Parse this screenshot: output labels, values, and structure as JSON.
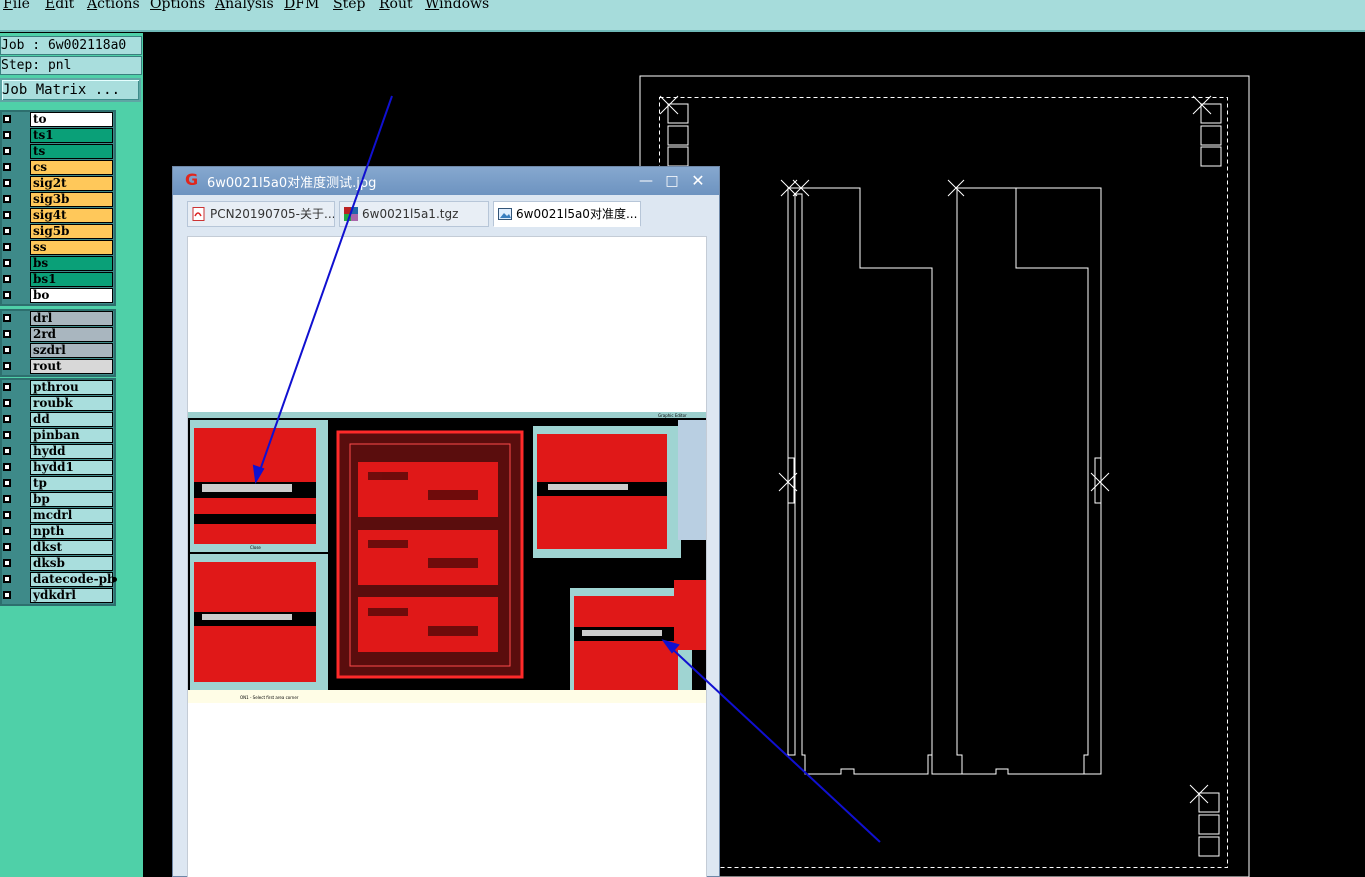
{
  "menubar": {
    "items": [
      {
        "u": "F",
        "rest": "ile"
      },
      {
        "u": "E",
        "rest": "dit"
      },
      {
        "u": "A",
        "rest": "ctions"
      },
      {
        "u": "O",
        "rest": "ptions"
      },
      {
        "u": "A",
        "rest": "nalysis"
      },
      {
        "u": "D",
        "rest": "FM"
      },
      {
        "u": "S",
        "rest": "tep"
      },
      {
        "u": "R",
        "rest": "out"
      },
      {
        "u": "W",
        "rest": "indows"
      }
    ]
  },
  "left_panel": {
    "job": "Job : 6w002118a0",
    "step": "Step: pnl",
    "job_matrix_button": "Job Matrix ...",
    "groups": [
      {
        "layers": [
          {
            "name": "to",
            "color": "#ffffff"
          },
          {
            "name": "ts1",
            "color": "#0aa078"
          },
          {
            "name": "ts",
            "color": "#0aa078"
          },
          {
            "name": "cs",
            "color": "#ffc85a"
          },
          {
            "name": "sig2t",
            "color": "#ffc85a"
          },
          {
            "name": "sig3b",
            "color": "#ffc85a"
          },
          {
            "name": "sig4t",
            "color": "#ffc85a"
          },
          {
            "name": "sig5b",
            "color": "#ffc85a"
          },
          {
            "name": "ss",
            "color": "#ffc85a"
          },
          {
            "name": "bs",
            "color": "#0aa078"
          },
          {
            "name": "bs1",
            "color": "#0aa078"
          },
          {
            "name": "bo",
            "color": "#ffffff"
          }
        ]
      },
      {
        "layers": [
          {
            "name": "drl",
            "color": "#a9b6bf"
          },
          {
            "name": "2rd",
            "color": "#a9b6bf"
          },
          {
            "name": "szdrl",
            "color": "#a9b6bf"
          },
          {
            "name": "rout",
            "color": "#d8d8d8"
          }
        ]
      },
      {
        "layers": [
          {
            "name": "pthrou",
            "color": "#a9dedd"
          },
          {
            "name": "roubk",
            "color": "#a9dedd"
          },
          {
            "name": "dd",
            "color": "#a9dedd"
          },
          {
            "name": "pinban",
            "color": "#a9dedd"
          },
          {
            "name": "hydd",
            "color": "#a9dedd"
          },
          {
            "name": "hydd1",
            "color": "#a9dedd"
          },
          {
            "name": "tp",
            "color": "#a9dedd"
          },
          {
            "name": "bp",
            "color": "#a9dedd"
          },
          {
            "name": "mcdrl",
            "color": "#a9dedd"
          },
          {
            "name": "npth",
            "color": "#a9dedd"
          },
          {
            "name": "dkst",
            "color": "#a9dedd"
          },
          {
            "name": "dksb",
            "color": "#a9dedd"
          },
          {
            "name": "datecode-pb",
            "color": "#a9dedd",
            "dot": true
          },
          {
            "name": "ydkdrl",
            "color": "#a9dedd"
          }
        ]
      }
    ]
  },
  "viewer": {
    "title": "6w0021l5a0对准度测试.jpg",
    "tabs": [
      {
        "label": "PCN20190705-关于...",
        "icon": "pdf-icon",
        "active": false
      },
      {
        "label": "6w0021l5a1.tgz",
        "icon": "archive-icon",
        "active": false
      },
      {
        "label": "6w0021l5a0对准度...",
        "icon": "image-icon",
        "active": true
      }
    ],
    "embedded": {
      "popup_button": "Close",
      "status_text": "ON1 - Select first area corner",
      "header_text": "Graphic Editor"
    }
  },
  "colors": {
    "menubar": "#a6dcdb",
    "panel": "#4fd0a8",
    "annotation_arrow": "#1010d0",
    "pcb_red": "#e01818"
  }
}
